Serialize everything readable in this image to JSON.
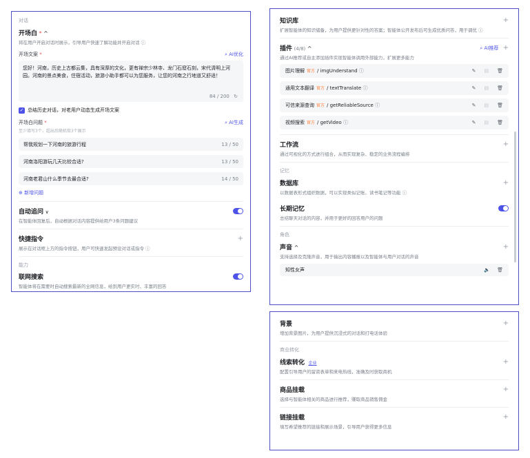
{
  "left": {
    "section_dialog": "对话",
    "opening": {
      "title": "开场白",
      "required": "*",
      "chevron": "^",
      "desc": "将在用户开启对话时展示，引导用户快速了解功能并开启对话",
      "help_icon": "ⓘ"
    },
    "opening_text": {
      "label": "开场文案",
      "required": "*",
      "ai_optimize": "AI优化",
      "content": "您好！河南，历史上古都云集，具有深厚的文化，更有禅宗少林寺、龙门石窟石刻，宋代清明上河园。河南的景点美食，住宿活动，旅游小助手都可以为您服务，让您的河南之行地道又舒适！",
      "counter": "84 / 200"
    },
    "checkbox_label": "总结历史对话，对老用户动态生成开场文案",
    "questions": {
      "label": "开场白问题",
      "required": "*",
      "hint": "至少填写3个，超出后随机取3个展示",
      "ai_generate": "AI生成",
      "items": [
        {
          "text": "帮我规划一下河南的旅游行程",
          "count": "13 / 50"
        },
        {
          "text": "河南洛阳游玩几天比较合适?",
          "count": "13 / 50"
        },
        {
          "text": "河南老君山什么季节去最合适?",
          "count": "14 / 50"
        }
      ],
      "add_label": "新增问题"
    },
    "auto_followup": {
      "title": "自动追问",
      "desc": "在智能体回复后，自动根据对话内容提供给用户3条问题建议"
    },
    "shortcut": {
      "title": "快捷指令",
      "desc": "展示在对话框上方的指令按钮，用户可快速发起预设对话或指令"
    },
    "section_ability": "能力",
    "web_search": {
      "title": "联网搜索",
      "desc": "智能体将在需要时自动搜索最新的全网信息，给到用户更实时、丰富的回答"
    }
  },
  "right_top": {
    "knowledge": {
      "title": "知识库",
      "desc": "扩展智能体的知识储备，为用户提供更针对性的答案；智能体公开发布后可生成优质问答，用于调优"
    },
    "plugins": {
      "title": "插件",
      "count": "(4/8)",
      "chevron": "^",
      "ai_recommend": "AI推荐",
      "desc": "通过AI推荐或自主添加插件实现智能体调用外部能力，扩展更多能力",
      "official": "官方",
      "items": [
        {
          "name": "图片理解",
          "api": "/ imgUnderstand"
        },
        {
          "name": "通用文本翻译",
          "api": "/ textTranslate"
        },
        {
          "name": "可信来源查询",
          "api": "/ getReliableSource"
        },
        {
          "name": "视频搜索",
          "api": "/ getVideo"
        }
      ]
    },
    "workflow": {
      "title": "工作流",
      "desc": "通过可视化的方式进行组合，从而实现复杂、稳定的业务流程编排"
    },
    "section_memory": "记忆",
    "database": {
      "title": "数据库",
      "desc": "以数据表形式组织数据，可以实现类似记账、读书笔记等功能"
    },
    "long_memory": {
      "title": "长期记忆",
      "desc": "总结聊天对话的内容，并用于更好的回答用户的问题"
    },
    "section_role": "角色",
    "voice": {
      "title": "声音",
      "chevron": "^",
      "desc": "支持选择及克隆声音，用于输出内容播报以及智能体与用户对话的声音",
      "selected": "知性女声"
    }
  },
  "right_bottom": {
    "background": {
      "title": "背景",
      "desc": "增加背景图片，为用户提供沉浸式的对话和打电话体验"
    },
    "section_business": "商业转化",
    "leads": {
      "title": "线索转化",
      "tag": "企业",
      "desc": "配置引导用户的留资表单和来电热线，准确及时获取商机"
    },
    "goods": {
      "title": "商品挂载",
      "desc": "选择与智能体相关的商品进行推荐，赚取商品销售佣金"
    },
    "links": {
      "title": "链接挂载",
      "desc": "填写希望推荐的链接和展示场景，引导用户获得更多信息"
    }
  },
  "colors": {
    "accent": "#4d53e8",
    "border": "#4c4cc4",
    "required": "#e84b4b",
    "official_tag": "#ff7a2f"
  }
}
